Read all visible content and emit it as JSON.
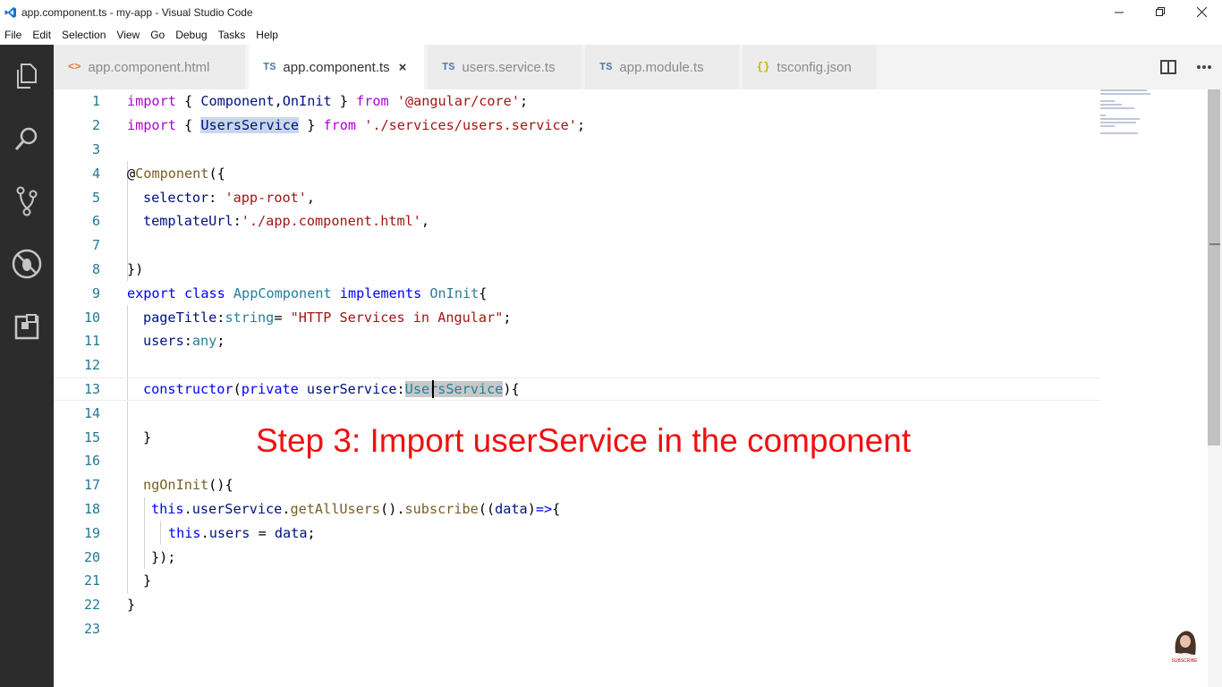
{
  "window": {
    "title": "app.component.ts - my-app - Visual Studio Code",
    "controls": [
      "minimize",
      "restore",
      "close"
    ]
  },
  "menu": [
    "File",
    "Edit",
    "Selection",
    "View",
    "Go",
    "Debug",
    "Tasks",
    "Help"
  ],
  "activity_bar": [
    "explorer-icon",
    "search-icon",
    "source-control-icon",
    "debug-icon",
    "extensions-icon"
  ],
  "tabs": [
    {
      "label": "app.component.html",
      "icon": "<>",
      "type": "html",
      "active": false
    },
    {
      "label": "app.component.ts",
      "icon": "TS",
      "type": "ts",
      "active": true,
      "close": "×"
    },
    {
      "label": "users.service.ts",
      "icon": "TS",
      "type": "ts",
      "active": false
    },
    {
      "label": "app.module.ts",
      "icon": "TS",
      "type": "ts",
      "active": false
    },
    {
      "label": "tsconfig.json",
      "icon": "{}",
      "type": "json",
      "active": false
    }
  ],
  "editor_actions": [
    "split-editor-icon",
    "more-actions-icon"
  ],
  "code_lines": [
    {
      "n": "1"
    },
    {
      "n": "2"
    },
    {
      "n": "3"
    },
    {
      "n": "4"
    },
    {
      "n": "5"
    },
    {
      "n": "6"
    },
    {
      "n": "7"
    },
    {
      "n": "8"
    },
    {
      "n": "9"
    },
    {
      "n": "10"
    },
    {
      "n": "11"
    },
    {
      "n": "12"
    },
    {
      "n": "13"
    },
    {
      "n": "14"
    },
    {
      "n": "15"
    },
    {
      "n": "16"
    },
    {
      "n": "17"
    },
    {
      "n": "18"
    },
    {
      "n": "19"
    },
    {
      "n": "20"
    },
    {
      "n": "21"
    },
    {
      "n": "22"
    },
    {
      "n": "23"
    }
  ],
  "code": {
    "l1": {
      "a": "import",
      "b": " { ",
      "c": "Component",
      "d": ",",
      "e": "OnInit",
      "f": " } ",
      "g": "from",
      "h": " ",
      "i": "'@angular/core'",
      "j": ";"
    },
    "l2": {
      "a": "import",
      "b": " { ",
      "c": "UsersService",
      "d": " } ",
      "e": "from",
      "f": " ",
      "g": "'./services/users.service'",
      "h": ";"
    },
    "l4": {
      "a": "@",
      "b": "Component",
      "c": "({"
    },
    "l5": {
      "a": "selector",
      "b": ": ",
      "c": "'app-root'",
      "d": ","
    },
    "l6": {
      "a": "templateUrl",
      "b": ":",
      "c": "'./app.component.html'",
      "d": ","
    },
    "l8": {
      "a": "})"
    },
    "l9": {
      "a": "export",
      "b": " ",
      "c": "class",
      "d": " ",
      "e": "AppComponent",
      "f": " ",
      "g": "implements",
      "h": " ",
      "i": "OnInit",
      "j": "{"
    },
    "l10": {
      "a": "pageTitle",
      "b": ":",
      "c": "string",
      "d": "= ",
      "e": "\"HTTP Services in Angular\"",
      "f": ";"
    },
    "l11": {
      "a": "users",
      "b": ":",
      "c": "any",
      "d": ";"
    },
    "l13": {
      "a": "constructor",
      "b": "(",
      "c": "private",
      "d": " ",
      "e": "userService",
      "f": ":",
      "g": "UsersService",
      "h": "){"
    },
    "l15": {
      "a": "}"
    },
    "l17": {
      "a": "ngOnInit",
      "b": "(){"
    },
    "l18": {
      "a": "this",
      "b": ".",
      "c": "userService",
      "d": ".",
      "e": "getAllUsers",
      "f": "().",
      "g": "subscribe",
      "h": "((",
      "i": "data",
      "j": ")",
      "k": "=>",
      "l": "{"
    },
    "l19": {
      "a": "this",
      "b": ".",
      "c": "users",
      "d": " = ",
      "e": "data",
      "f": ";"
    },
    "l20": {
      "a": "});"
    },
    "l21": {
      "a": "}"
    },
    "l22": {
      "a": "}"
    }
  },
  "overlay": {
    "caption": "Step 3: Import userService in the component"
  },
  "watermark": {
    "label": "SUBSCRIBE"
  }
}
